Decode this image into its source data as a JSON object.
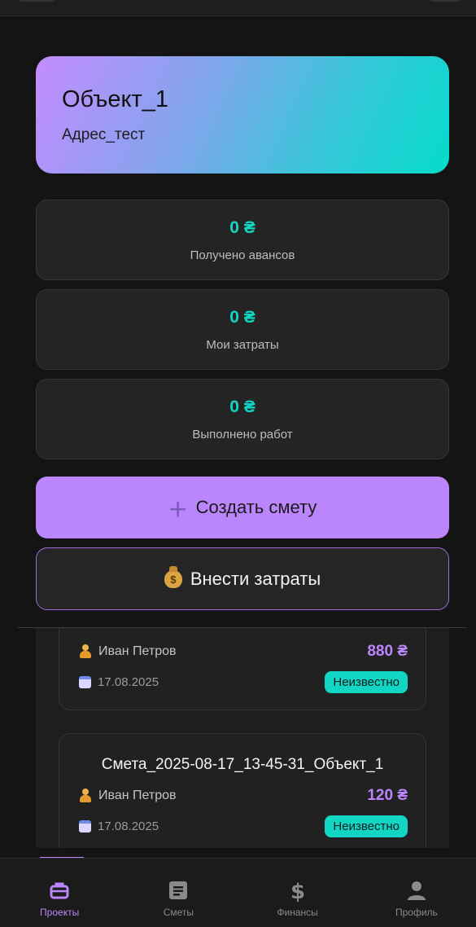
{
  "project": {
    "title": "Объект_1",
    "address": "Адрес_тест"
  },
  "stats": [
    {
      "value": "0 ₴",
      "label": "Получено авансов"
    },
    {
      "value": "0 ₴",
      "label": "Мои затраты"
    },
    {
      "value": "0 ₴",
      "label": "Выполнено работ"
    }
  ],
  "actions": {
    "create_estimate": "Создать смету",
    "add_expenses": "Внести затраты"
  },
  "estimates": [
    {
      "title": "",
      "person": "Иван Петров",
      "amount": "880 ₴",
      "date": "17.08.2025",
      "status": "Неизвестно"
    },
    {
      "title": "Смета_2025-08-17_13-45-31_Объект_1",
      "person": "Иван Петров",
      "amount": "120 ₴",
      "date": "17.08.2025",
      "status": "Неизвестно"
    }
  ],
  "nav": [
    {
      "label": "Проекты",
      "icon": "briefcase-icon",
      "active": true
    },
    {
      "label": "Сметы",
      "icon": "document-icon",
      "active": false
    },
    {
      "label": "Финансы",
      "icon": "dollar-icon",
      "active": false
    },
    {
      "label": "Профиль",
      "icon": "person-icon",
      "active": false
    }
  ],
  "colors": {
    "accent_purple": "#bb86fc",
    "accent_teal": "#12d6c4",
    "background": "#141414",
    "card": "#242424"
  }
}
